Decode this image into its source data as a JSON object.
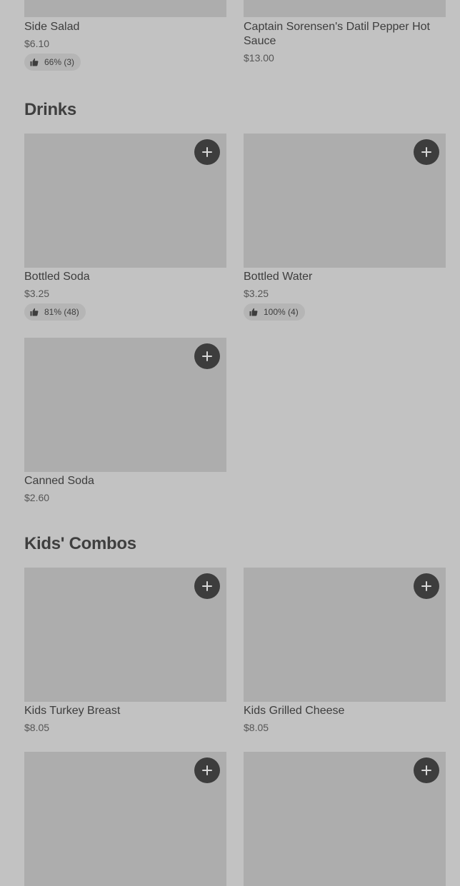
{
  "sections": {
    "drinks": {
      "title": "Drinks"
    },
    "kids": {
      "title": "Kids' Combos"
    }
  },
  "items": {
    "side_salad": {
      "name": "Side Salad",
      "price": "$6.10",
      "rating": "66% (3)"
    },
    "hot_sauce": {
      "name": "Captain Sorensen's Datil Pepper Hot Sauce",
      "price": "$13.00"
    },
    "bottled_soda": {
      "name": "Bottled Soda",
      "price": "$3.25",
      "rating": "81% (48)"
    },
    "bottled_water": {
      "name": "Bottled Water",
      "price": "$3.25",
      "rating": "100% (4)"
    },
    "canned_soda": {
      "name": "Canned Soda",
      "price": "$2.60"
    },
    "kids_turkey": {
      "name": "Kids Turkey Breast",
      "price": "$8.05"
    },
    "kids_grilled_cheese": {
      "name": "Kids Grilled Cheese",
      "price": "$8.05"
    }
  },
  "icons": {
    "add": "plus-icon",
    "rating": "thumbs-up-icon"
  },
  "colors": {
    "background": "#c2c2c2",
    "image_placeholder": "#adadad",
    "add_button": "#3d3d3d"
  }
}
